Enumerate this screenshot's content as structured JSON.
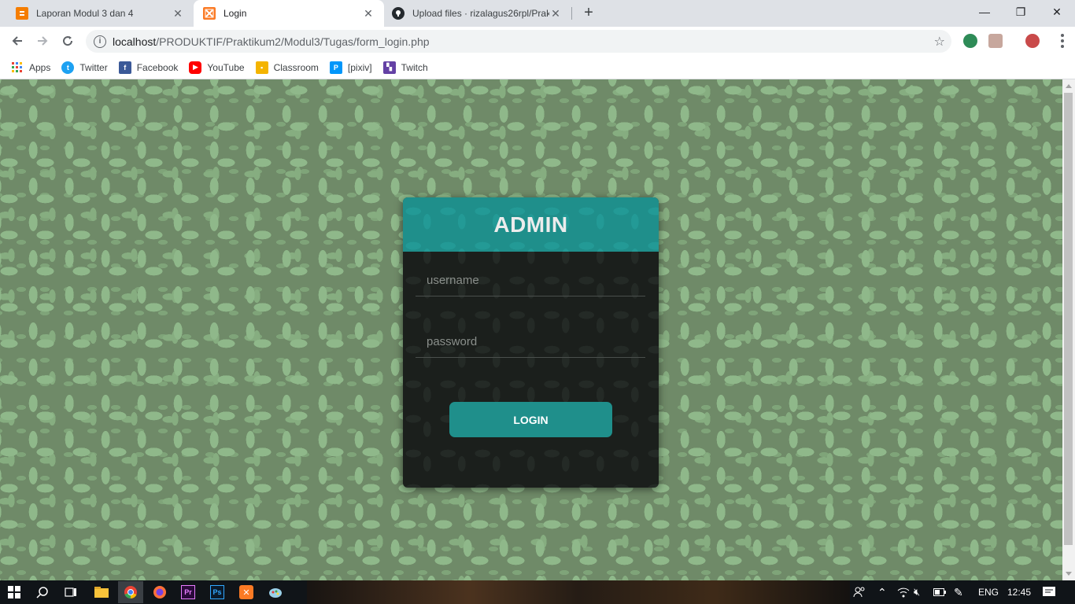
{
  "tabs": [
    {
      "title": "Laporan Modul 3 dan 4",
      "favicon": "blogger-icon",
      "favicon_color": "#f57d00",
      "active": false
    },
    {
      "title": "Login",
      "favicon": "xampp-icon",
      "favicon_color": "#fb7a24",
      "active": true
    },
    {
      "title": "Upload files · rizalagus26rpl/Prak",
      "favicon": "github-icon",
      "favicon_color": "#24292e",
      "active": false
    }
  ],
  "new_tab_label": "+",
  "window_controls": {
    "minimize": "—",
    "maximize": "❐",
    "close": "✕"
  },
  "address_bar": {
    "host": "localhost",
    "path": "/PRODUKTIF/Praktikum2/Modul3/Tugas/form_login.php"
  },
  "bookmarks": [
    {
      "label": "Apps",
      "icon": "apps-grid-icon",
      "color": "#ea4335"
    },
    {
      "label": "Twitter",
      "icon": "twitter-icon",
      "color": "#1da1f2"
    },
    {
      "label": "Facebook",
      "icon": "facebook-icon",
      "color": "#3b5998"
    },
    {
      "label": "YouTube",
      "icon": "youtube-icon",
      "color": "#ff0000"
    },
    {
      "label": "Classroom",
      "icon": "classroom-icon",
      "color": "#f4b400"
    },
    {
      "label": "[pixiv]",
      "icon": "pixiv-icon",
      "color": "#0096fa"
    },
    {
      "label": "Twitch",
      "icon": "twitch-icon",
      "color": "#6441a5"
    }
  ],
  "login": {
    "title": "ADMIN",
    "username_placeholder": "username",
    "password_placeholder": "password",
    "button_label": "LOGIN",
    "accent_color": "#1f8f8b"
  },
  "taskbar": {
    "language": "ENG",
    "time": "12:45"
  }
}
